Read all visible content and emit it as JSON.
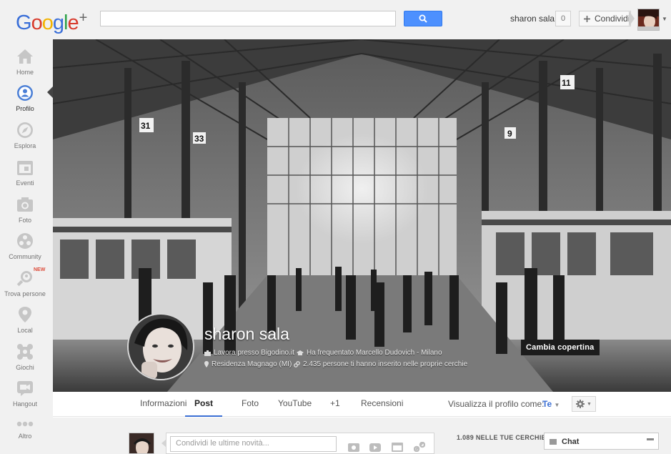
{
  "header": {
    "logo": {
      "letters": [
        "G",
        "o",
        "o",
        "g",
        "l",
        "e"
      ],
      "plus": "+"
    },
    "search": {
      "value": "",
      "placeholder": "",
      "button_icon": "search-icon"
    },
    "user_name": "sharon sala",
    "notification_count": "0",
    "share_label": "Condividi"
  },
  "sidebar": {
    "items": [
      {
        "label": "Home",
        "icon": "home-icon",
        "active": false
      },
      {
        "label": "Profilo",
        "icon": "profile-icon",
        "active": true
      },
      {
        "label": "Esplora",
        "icon": "compass-icon",
        "active": false
      },
      {
        "label": "Eventi",
        "icon": "calendar-icon",
        "active": false
      },
      {
        "label": "Foto",
        "icon": "camera-icon",
        "active": false
      },
      {
        "label": "Community",
        "icon": "community-icon",
        "active": false
      },
      {
        "label": "Trova persone",
        "icon": "find-people-icon",
        "active": false,
        "badge": "NEW"
      },
      {
        "label": "Local",
        "icon": "map-pin-icon",
        "active": false
      },
      {
        "label": "Giochi",
        "icon": "games-icon",
        "active": false
      },
      {
        "label": "Hangout",
        "icon": "hangout-icon",
        "active": false
      },
      {
        "label": "Altro",
        "icon": "more-icon",
        "active": false
      }
    ]
  },
  "profile": {
    "name": "sharon sala",
    "work": "Lavora presso Bigodino.it",
    "education": "Ha frequentato Marcello Dudovich - Milano",
    "residence": "Residenza Magnago (MI)",
    "circled_by": "2.435 persone ti hanno inserito nelle proprie cerchie",
    "change_cover_label": "Cambia copertina"
  },
  "tabs": {
    "items": [
      "Informazioni",
      "Post",
      "Foto",
      "YouTube",
      "+1",
      "Recensioni"
    ],
    "active": "Post",
    "view_as_label": "Visualizza il profilo come:",
    "view_as_value": "Te"
  },
  "stream": {
    "share_placeholder": "Condividi le ultime novità...",
    "share_icons": [
      "photo-icon",
      "video-icon",
      "event-icon",
      "link-icon"
    ],
    "circles_label": "1.089 NELLE TUE CERCHIE",
    "chat_label": "Chat"
  }
}
